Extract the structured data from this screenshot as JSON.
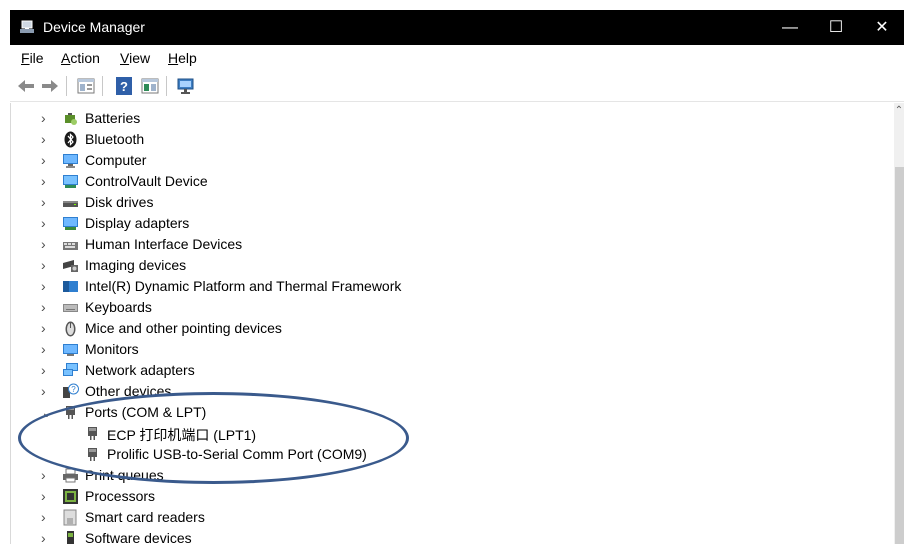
{
  "window": {
    "title": "Device Manager",
    "minimize": "—",
    "maximize": "☐",
    "close": "✕"
  },
  "menu": {
    "file": "File",
    "action": "Action",
    "view": "View",
    "help": "Help"
  },
  "toolbar": {
    "buttons": [
      "back-icon",
      "forward-icon",
      "properties-icon",
      "help-icon",
      "update-driver-icon",
      "scan-hardware-icon"
    ]
  },
  "tree": [
    {
      "label": "Batteries",
      "icon": "battery-icon",
      "expanded": false
    },
    {
      "label": "Bluetooth",
      "icon": "bluetooth-icon",
      "expanded": false
    },
    {
      "label": "Computer",
      "icon": "computer-icon",
      "expanded": false
    },
    {
      "label": "ControlVault Device",
      "icon": "controlvault-icon",
      "expanded": false
    },
    {
      "label": "Disk drives",
      "icon": "disk-drive-icon",
      "expanded": false
    },
    {
      "label": "Display adapters",
      "icon": "display-adapter-icon",
      "expanded": false
    },
    {
      "label": "Human Interface Devices",
      "icon": "hid-icon",
      "expanded": false
    },
    {
      "label": "Imaging devices",
      "icon": "camera-icon",
      "expanded": false
    },
    {
      "label": "Intel(R) Dynamic Platform and Thermal Framework",
      "icon": "intel-icon",
      "expanded": false
    },
    {
      "label": "Keyboards",
      "icon": "keyboard-icon",
      "expanded": false
    },
    {
      "label": "Mice and other pointing devices",
      "icon": "mouse-icon",
      "expanded": false
    },
    {
      "label": "Monitors",
      "icon": "monitor-icon",
      "expanded": false
    },
    {
      "label": "Network adapters",
      "icon": "network-icon",
      "expanded": false
    },
    {
      "label": "Other devices",
      "icon": "unknown-device-icon",
      "expanded": false
    },
    {
      "label": "Ports (COM & LPT)",
      "icon": "port-icon",
      "expanded": true,
      "children": [
        {
          "label": "ECP 打印机端口 (LPT1)",
          "icon": "port-icon"
        },
        {
          "label": "Prolific USB-to-Serial Comm Port (COM9)",
          "icon": "port-icon"
        }
      ]
    },
    {
      "label": "Print queues",
      "icon": "printer-icon",
      "expanded": false
    },
    {
      "label": "Processors",
      "icon": "processor-icon",
      "expanded": false
    },
    {
      "label": "Smart card readers",
      "icon": "smartcard-icon",
      "expanded": false
    },
    {
      "label": "Software devices",
      "icon": "software-device-icon",
      "expanded": false
    }
  ],
  "colors": {
    "titlebar": "#000000",
    "highlight_oval": "#3a5a8c"
  }
}
